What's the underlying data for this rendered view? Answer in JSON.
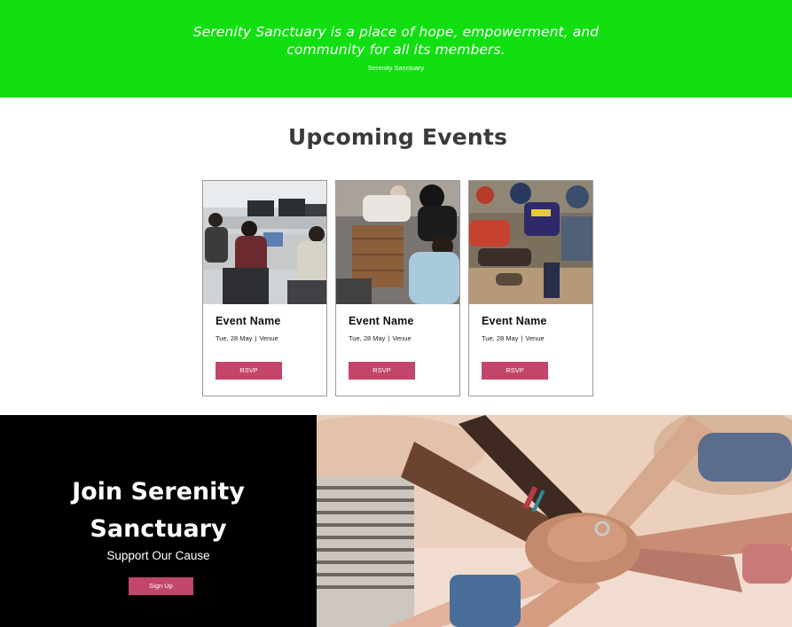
{
  "hero": {
    "quote_line1": "Serenity Sanctuary is a place of hope, empowerment, and",
    "quote_line2": "community for all its members.",
    "attribution": "Serenity Sanctuary",
    "color": "#12df12"
  },
  "events": {
    "title": "Upcoming Events",
    "cards": [
      {
        "name": "Event Name",
        "date": "Tue, 28 May",
        "separator": "|",
        "venue": "Venue",
        "button": "RSVP",
        "image": "computer-lab-photo"
      },
      {
        "name": "Event Name",
        "date": "Tue, 28 May",
        "separator": "|",
        "venue": "Venue",
        "button": "RSVP",
        "image": "volunteers-boxes-photo"
      },
      {
        "name": "Event Name",
        "date": "Tue, 28 May",
        "separator": "|",
        "venue": "Venue",
        "button": "RSVP",
        "image": "protest-police-photo"
      }
    ],
    "accent": "#c4456a"
  },
  "join": {
    "title_line1": "Join Serenity",
    "title_line2": "Sanctuary",
    "subtitle": "Support Our Cause",
    "button": "Sign Up",
    "image": "hands-together-photo"
  }
}
